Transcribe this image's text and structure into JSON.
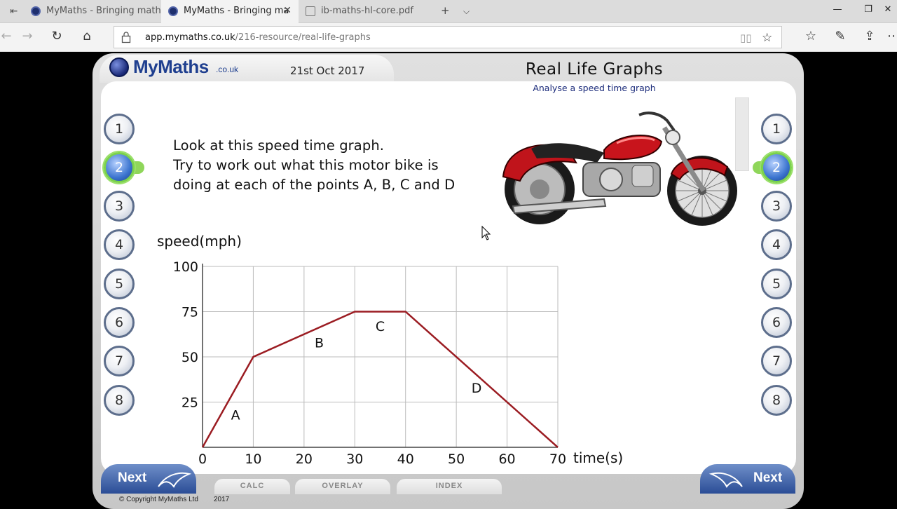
{
  "browser": {
    "tabs": [
      {
        "title": "MyMaths - Bringing maths a"
      },
      {
        "title": "MyMaths - Bringing ma"
      },
      {
        "title": "ib-maths-hl-core.pdf"
      }
    ],
    "url_host": "app.mymaths.co.uk",
    "url_path": "/216-resource/real-life-graphs"
  },
  "header": {
    "logo_text": "MyMaths",
    "logo_domain": ".co.uk",
    "date": "21st Oct 2017",
    "title": "Real Life Graphs",
    "subtitle": "Analyse a speed time graph"
  },
  "questions": {
    "left": [
      "1",
      "2",
      "3",
      "4",
      "5",
      "6",
      "7",
      "8"
    ],
    "right": [
      "1",
      "2",
      "3",
      "4",
      "5",
      "6",
      "7",
      "8"
    ],
    "selected": "2"
  },
  "intro": {
    "line1": "Look at this speed time graph.",
    "line2": "Try to work out what this motor bike is",
    "line3": "doing at each of the points A, B, C and D"
  },
  "chart_data": {
    "type": "line",
    "ylabel": "speed(mph)",
    "xlabel": "time(s)",
    "xlim": [
      0,
      70
    ],
    "ylim": [
      0,
      100
    ],
    "x_ticks": [
      "0",
      "10",
      "20",
      "30",
      "40",
      "50",
      "60",
      "70"
    ],
    "y_ticks": [
      "25",
      "50",
      "75",
      "100"
    ],
    "grid": true,
    "line_color": "#9b1c22",
    "series": [
      {
        "x": [
          0,
          10,
          30,
          40,
          70
        ],
        "y": [
          0,
          50,
          75,
          75,
          0
        ]
      }
    ],
    "annotations": [
      {
        "text": "A",
        "x": 6.5,
        "y": 18
      },
      {
        "text": "B",
        "x": 23,
        "y": 58
      },
      {
        "text": "C",
        "x": 35,
        "y": 67
      },
      {
        "text": "D",
        "x": 54,
        "y": 33
      }
    ]
  },
  "buttons": {
    "next_left": "Next",
    "next_right": "Next"
  },
  "footer": {
    "tabs": [
      "CALC",
      "OVERLAY",
      "INDEX"
    ],
    "copyright": "© Copyright MyMaths Ltd",
    "year": "2017"
  },
  "colors": {
    "brand_blue": "#1f3f8f",
    "selected_green": "#8fd65a"
  }
}
